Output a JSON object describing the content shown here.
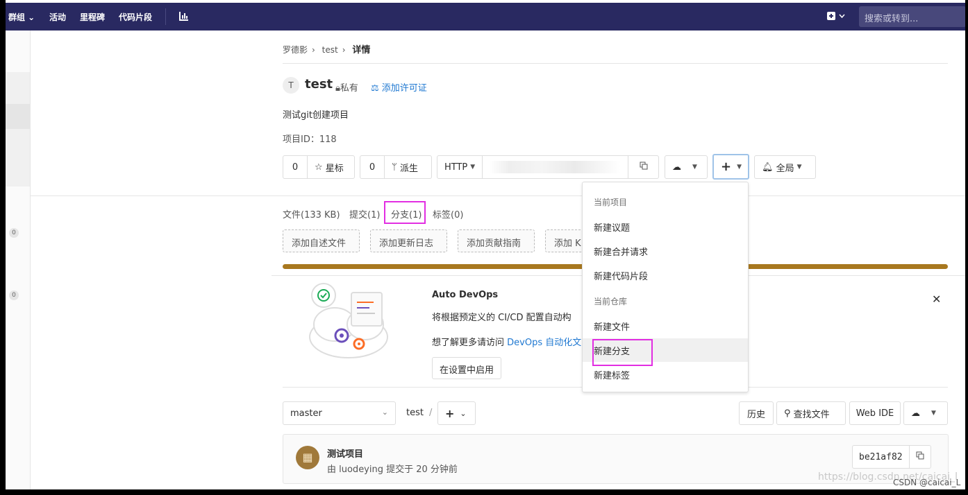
{
  "topnav": {
    "groups": "群组 ⌄",
    "activity": "活动",
    "milestones": "里程碑",
    "snippets": "代码片段",
    "search_placeholder": "搜索或转到..."
  },
  "sidebar": {
    "count1": "0",
    "count2": "0"
  },
  "breadcrumb": {
    "owner": "罗德影",
    "project": "test",
    "current": "详情"
  },
  "project": {
    "avatar_letter": "T",
    "name": "test",
    "visibility": "私有",
    "license_link": "添加许可证",
    "description": "测试git创建项目",
    "id_label": "项目ID：118"
  },
  "actions": {
    "star_count": "0",
    "star_label": "星标",
    "fork_count": "0",
    "fork_label": "派生",
    "clone_protocol": "HTTP",
    "notify_label": "全局"
  },
  "stats": {
    "files": "文件(133 KB)",
    "commits": "提交(1)",
    "branches": "分支(1)",
    "tags": "标签(0)"
  },
  "quick_add": [
    "添加自述文件",
    "添加更新日志",
    "添加贡献指南",
    "添加 K"
  ],
  "auto_devops": {
    "title": "Auto DevOps",
    "text": "将根据预定义的 CI/CD 配置自动构",
    "more_prefix": "想了解更多请访问 ",
    "more_link": "DevOps 自动化文",
    "enable_button": "在设置中启用"
  },
  "dropdown": {
    "header_project": "当前项目",
    "new_issue": "新建议题",
    "new_mr": "新建合并请求",
    "new_snippet": "新建代码片段",
    "header_repo": "当前仓库",
    "new_file": "新建文件",
    "new_branch": "新建分支",
    "new_tag": "新建标签"
  },
  "repo_bar": {
    "branch": "master",
    "path_root": "test",
    "path_sep": "/",
    "history": "历史",
    "find_file": "查找文件",
    "web_ide": "Web IDE"
  },
  "commit": {
    "avatar_glyph": "▦",
    "title": "测试项目",
    "meta": "由 luodeying 提交于 20 分钟前",
    "sha": "be21af82"
  },
  "watermark": "https://blog.csdn.net/caicai_l",
  "csdn_label": "CSDN @caicai_L",
  "colors": {
    "nav_bg": "#292961",
    "progress": "#a8781f",
    "highlight": "#e22ee2",
    "link": "#1f78d1"
  }
}
